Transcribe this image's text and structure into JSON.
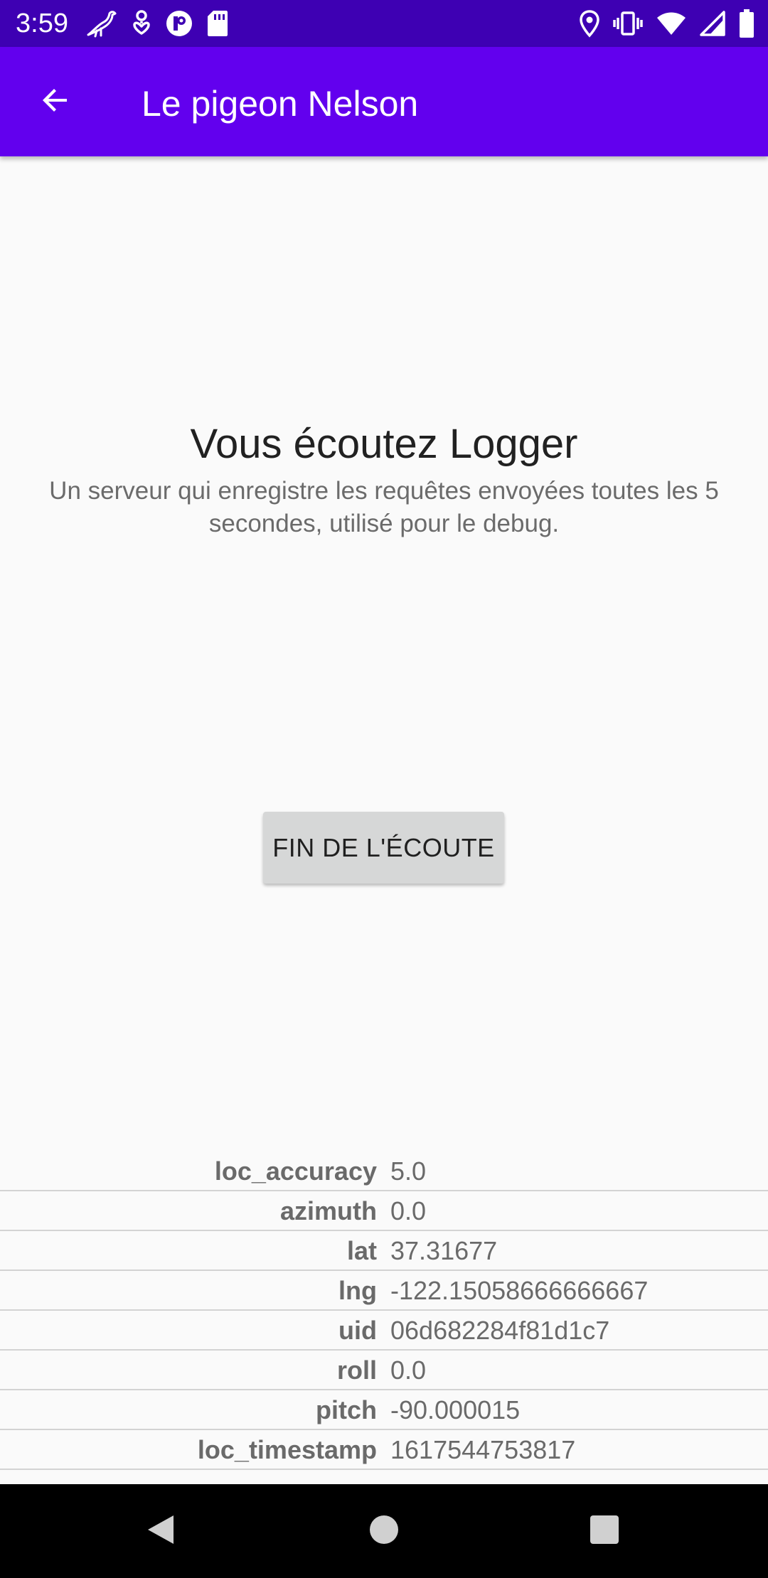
{
  "status_bar": {
    "time": "3:59",
    "left_icons": [
      "pigeon-icon",
      "location-share-icon",
      "p-badge-icon",
      "sd-card-icon"
    ],
    "right_icons": [
      "location-icon",
      "vibrate-icon",
      "wifi-icon",
      "signal-icon",
      "battery-icon"
    ]
  },
  "app_bar": {
    "title": "Le pigeon Nelson",
    "back_icon": "arrow-back-icon"
  },
  "main": {
    "heading": "Vous écoutez Logger",
    "description": "Un serveur qui enregistre les requêtes envoyées toutes les 5 secondes, utilisé pour le debug.",
    "stop_button_label": "FIN DE L'ÉCOUTE"
  },
  "params": [
    {
      "key": "loc_accuracy",
      "value": "5.0"
    },
    {
      "key": "azimuth",
      "value": "0.0"
    },
    {
      "key": "lat",
      "value": "37.31677"
    },
    {
      "key": "lng",
      "value": "-122.15058666666667"
    },
    {
      "key": "uid",
      "value": "06d682284f81d1c7"
    },
    {
      "key": "roll",
      "value": "0.0"
    },
    {
      "key": "pitch",
      "value": "-90.000015"
    },
    {
      "key": "loc_timestamp",
      "value": "1617544753817"
    }
  ],
  "nav_bar": {
    "icons": [
      "back-triangle-icon",
      "home-circle-icon",
      "recents-square-icon"
    ]
  },
  "colors": {
    "status_bar": "#3E00B3",
    "app_bar": "#6200EE",
    "background": "#FAFAFA",
    "button": "#D6D7D7"
  }
}
